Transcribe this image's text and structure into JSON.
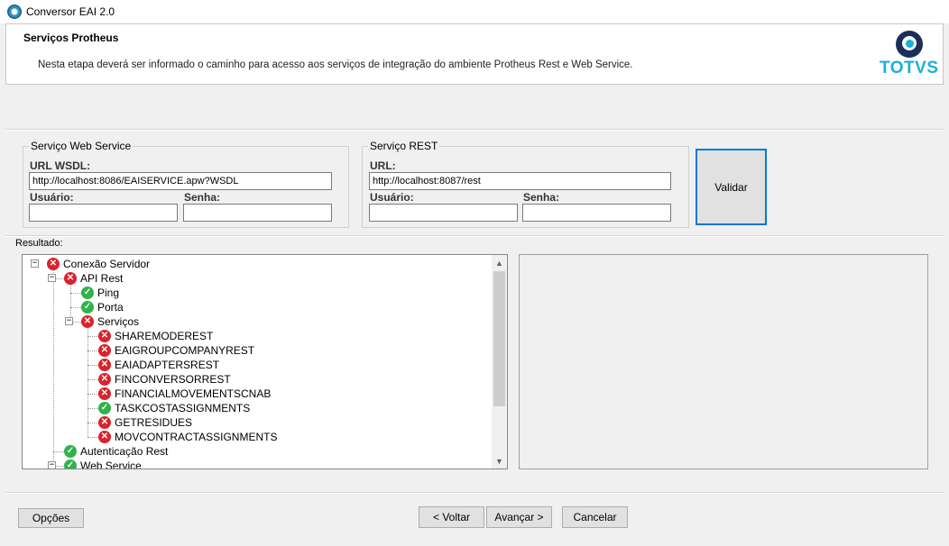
{
  "window": {
    "title": "Conversor EAI 2.0"
  },
  "header": {
    "title": "Serviços Protheus",
    "description": "Nesta etapa deverá ser informado o caminho para acesso aos serviços de integração do ambiente Protheus Rest e Web Service.",
    "logo_text": "TOTVS"
  },
  "webservice": {
    "legend": "Serviço Web Service",
    "url_label": "URL WSDL:",
    "url_value": "http://localhost:8086/EAISERVICE.apw?WSDL",
    "user_label": "Usuário:",
    "user_value": "",
    "pass_label": "Senha:",
    "pass_value": ""
  },
  "rest": {
    "legend": "Serviço REST",
    "url_label": "URL:",
    "url_value": "http://localhost:8087/rest",
    "user_label": "Usuário:",
    "user_value": "",
    "pass_label": "Senha:",
    "pass_value": ""
  },
  "validate_button": "Validar",
  "result_label": "Resultado:",
  "tree": [
    {
      "label": "Conexão Servidor",
      "status": "error",
      "level": 0,
      "expanded": true
    },
    {
      "label": "API Rest",
      "status": "error",
      "level": 1,
      "expanded": true
    },
    {
      "label": "Ping",
      "status": "ok",
      "level": 2
    },
    {
      "label": "Porta",
      "status": "ok",
      "level": 2
    },
    {
      "label": "Serviços",
      "status": "error",
      "level": 2,
      "expanded": true
    },
    {
      "label": "SHAREMODEREST",
      "status": "error",
      "level": 3
    },
    {
      "label": "EAIGROUPCOMPANYREST",
      "status": "error",
      "level": 3
    },
    {
      "label": "EAIADAPTERSREST",
      "status": "error",
      "level": 3
    },
    {
      "label": "FINCONVERSORREST",
      "status": "error",
      "level": 3
    },
    {
      "label": "FINANCIALMOVEMENTSCNAB",
      "status": "error",
      "level": 3
    },
    {
      "label": "TASKCOSTASSIGNMENTS",
      "status": "ok",
      "level": 3
    },
    {
      "label": "GETRESIDUES",
      "status": "error",
      "level": 3
    },
    {
      "label": "MOVCONTRACTASSIGNMENTS",
      "status": "error",
      "level": 3
    },
    {
      "label": "Autenticação Rest",
      "status": "ok",
      "level": 1
    },
    {
      "label": "Web Service",
      "status": "ok",
      "level": 1,
      "expanded": true
    }
  ],
  "footer": {
    "options": "Opções",
    "back": "< Voltar",
    "next": "Avançar >",
    "cancel": "Cancelar"
  },
  "colors": {
    "error": "#d9232d",
    "ok": "#2fb34a",
    "focus": "#0078d7",
    "brand": "#1ab0d8"
  },
  "icons": {
    "error": "error-x-icon",
    "ok": "check-icon"
  }
}
